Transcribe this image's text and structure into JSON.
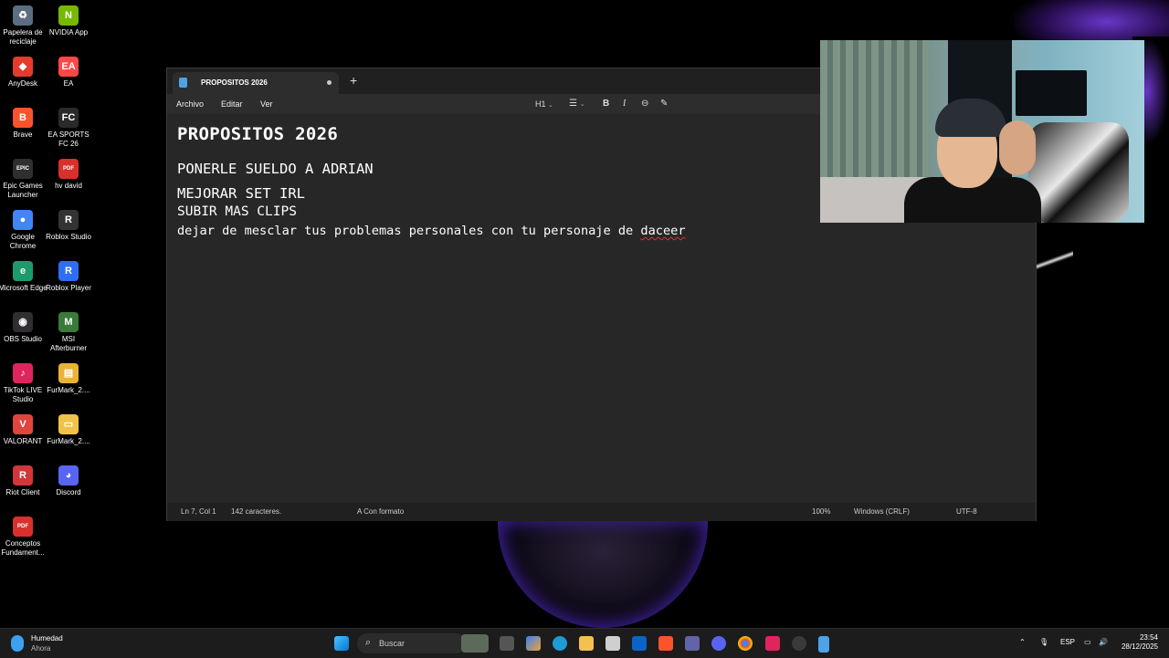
{
  "desktop": {
    "icons": [
      {
        "label": "Papelera de reciclaje",
        "color": "#5b6d80",
        "glyph": "♻"
      },
      {
        "label": "NVIDIA App",
        "color": "#76b900",
        "glyph": "N"
      },
      {
        "label": "AnyDesk",
        "color": "#e33b2e",
        "glyph": "◆"
      },
      {
        "label": "EA",
        "color": "#ff4747",
        "glyph": "EA"
      },
      {
        "label": "Brave",
        "color": "#fb542b",
        "glyph": "B"
      },
      {
        "label": "EA SPORTS FC 26",
        "color": "#2a2a2a",
        "glyph": "FC"
      },
      {
        "label": "Epic Games Launcher",
        "color": "#2f2f2f",
        "glyph": "EPIC"
      },
      {
        "label": "hv david",
        "color": "#d9302c",
        "glyph": "PDF"
      },
      {
        "label": "Google Chrome",
        "color": "#4285f4",
        "glyph": "●"
      },
      {
        "label": "Roblox Studio",
        "color": "#333",
        "glyph": "R"
      },
      {
        "label": "Microsoft Edge",
        "color": "#1d9b6c",
        "glyph": "e"
      },
      {
        "label": "Roblox Player",
        "color": "#2d6ef5",
        "glyph": "R"
      },
      {
        "label": "OBS Studio",
        "color": "#302e31",
        "glyph": "◉"
      },
      {
        "label": "MSI Afterburner",
        "color": "#3a7a3a",
        "glyph": "M"
      },
      {
        "label": "TikTok LIVE Studio",
        "color": "#e0245e",
        "glyph": "♪"
      },
      {
        "label": "FurMark_2....",
        "color": "#e9b23b",
        "glyph": "▤"
      },
      {
        "label": "VALORANT",
        "color": "#e0453d",
        "glyph": "V"
      },
      {
        "label": "FurMark_2....",
        "color": "#f0c24a",
        "glyph": "▭"
      },
      {
        "label": "Riot Client",
        "color": "#d13639",
        "glyph": "R"
      },
      {
        "label": "Discord",
        "color": "#5865f2",
        "glyph": "◕"
      },
      {
        "label": "Conceptos Fundament...",
        "color": "#d9302c",
        "glyph": "PDF"
      }
    ]
  },
  "notepad": {
    "tab_title": "PROPOSITOS 2026",
    "new_tab": "+",
    "menu": {
      "file": "Archivo",
      "edit": "Editar",
      "view": "Ver"
    },
    "toolbar": {
      "heading": "H1",
      "list": "☰",
      "bold": "B",
      "italic": "I",
      "link": "⊖",
      "clear": "✎"
    },
    "content": {
      "heading": "PROPOSITOS 2026",
      "lines": [
        "PONERLE SUELDO A ADRIAN",
        "MEJORAR SET IRL",
        "SUBIR MAS CLIPS"
      ],
      "last_line_prefix": "dejar de mesclar tus problemas personales con tu personaje de ",
      "last_line_misspelled": "daceer"
    },
    "status": {
      "position": "Ln 7, Col 1",
      "chars": "142 caracteres.",
      "format": "Con formato",
      "zoom": "100%",
      "line_ending": "Windows (CRLF)",
      "encoding": "UTF-8"
    }
  },
  "taskbar": {
    "weather_title": "Humedad",
    "weather_sub": "Ahora",
    "search_label": "Buscar",
    "language": "ESP",
    "time": "23:54",
    "date": "28/12/2025"
  }
}
